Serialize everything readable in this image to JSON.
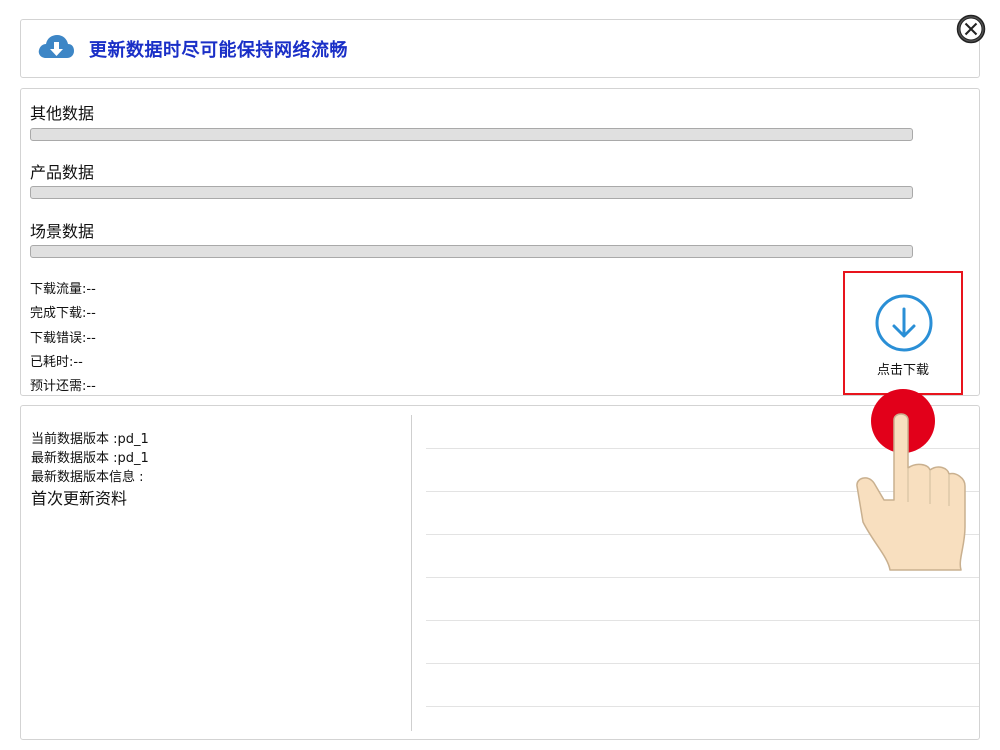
{
  "header": {
    "title": "更新数据时尽可能保持网络流畅",
    "icon": "cloud-download-icon",
    "icon_color": "#3d86c6"
  },
  "close": {
    "icon": "close-circle-icon"
  },
  "progress": {
    "bars": [
      {
        "label": "其他数据",
        "progress": 0
      },
      {
        "label": "产品数据",
        "progress": 0
      },
      {
        "label": "场景数据",
        "progress": 0
      }
    ]
  },
  "stats": [
    {
      "label": "下载流量:",
      "value": "--"
    },
    {
      "label": "完成下载:",
      "value": "--"
    },
    {
      "label": "下载错误:",
      "value": "--"
    },
    {
      "label": "已耗时:",
      "value": "--"
    },
    {
      "label": "预计还需:",
      "value": "--"
    }
  ],
  "download": {
    "label": "点击下载",
    "icon": "download-circle-icon",
    "icon_color": "#2a8fd6",
    "highlight_color": "#e8141d"
  },
  "version": {
    "current": "当前数据版本 :pd_1",
    "latest": "最新数据版本 :pd_1",
    "info_label": "最新数据版本信息 :",
    "info_text": "首次更新资料"
  },
  "overlay": {
    "icon": "hand-pointer-icon",
    "tap_color": "#e2001a"
  }
}
